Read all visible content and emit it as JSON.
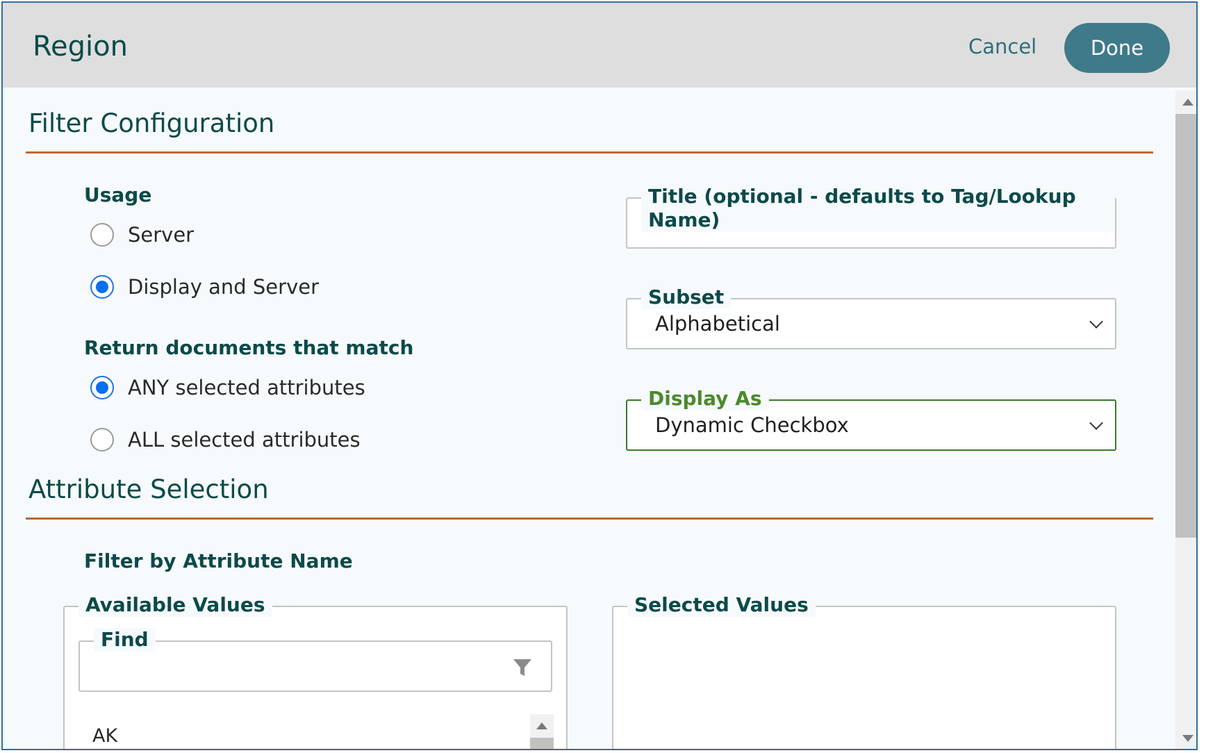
{
  "dialog": {
    "title": "Region",
    "cancel_label": "Cancel",
    "done_label": "Done"
  },
  "filter_config": {
    "heading": "Filter Configuration",
    "usage": {
      "label": "Usage",
      "options": [
        {
          "label": "Server",
          "checked": false
        },
        {
          "label": "Display and Server",
          "checked": true
        }
      ]
    },
    "match": {
      "label": "Return documents that match",
      "options": [
        {
          "label": "ANY selected attributes",
          "checked": true
        },
        {
          "label": "ALL selected attributes",
          "checked": false
        }
      ]
    },
    "title_field": {
      "legend": "Title (optional - defaults to Tag/Lookup Name)",
      "value": ""
    },
    "subset": {
      "legend": "Subset",
      "value": "Alphabetical"
    },
    "display_as": {
      "legend": "Display As",
      "value": "Dynamic Checkbox"
    }
  },
  "attribute_selection": {
    "heading": "Attribute Selection",
    "filter_label": "Filter by Attribute Name",
    "available": {
      "legend": "Available Values",
      "find_legend": "Find",
      "items": [
        "AK"
      ]
    },
    "selected": {
      "legend": "Selected Values",
      "items": []
    }
  },
  "colors": {
    "accent": "#3f7a8a",
    "rule": "#b86a34",
    "radio": "#0b6ff0",
    "focus": "#3a7a2a"
  }
}
